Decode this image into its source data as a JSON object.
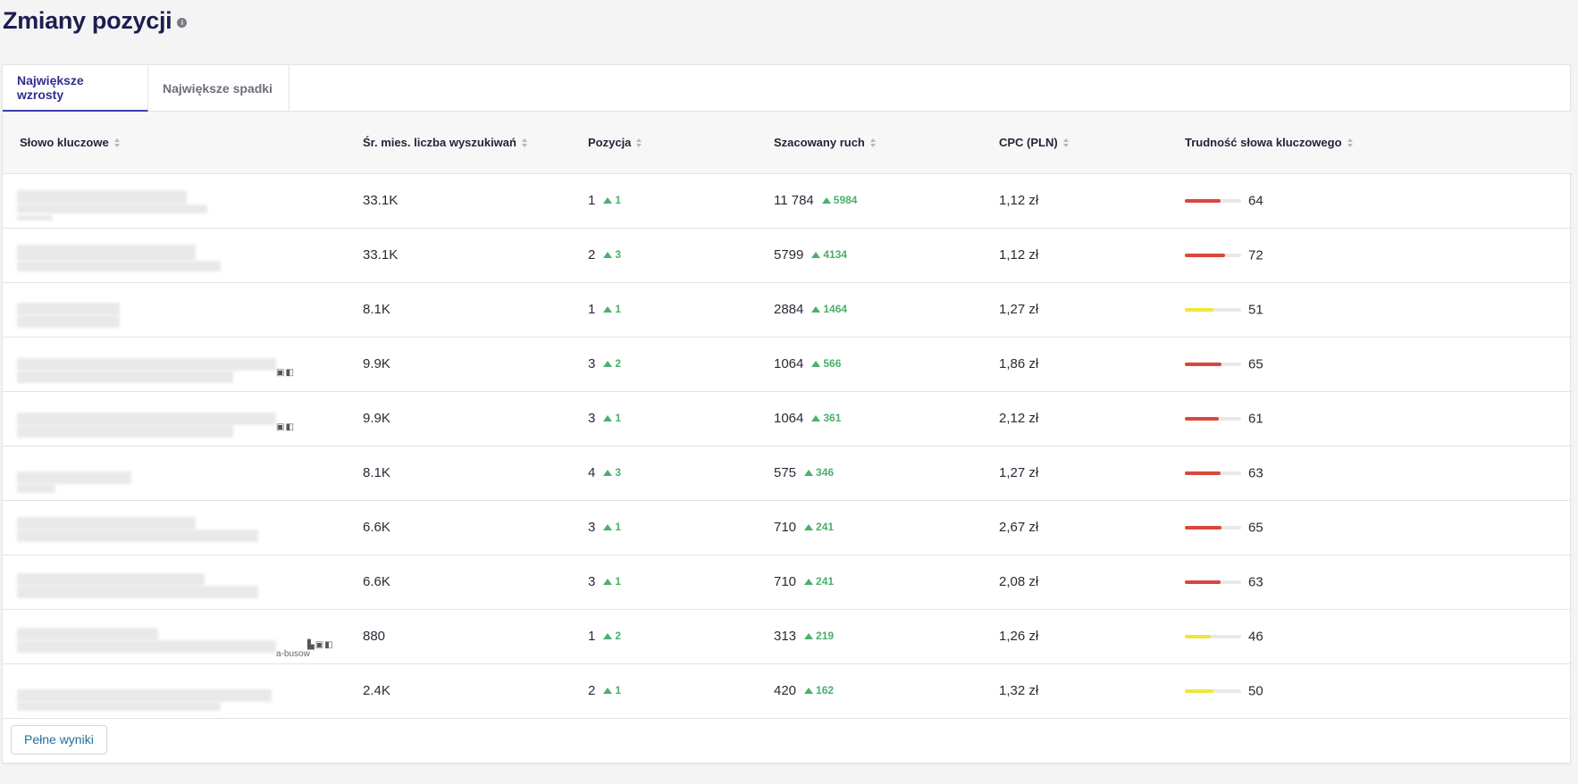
{
  "page": {
    "title": "Zmiany pozycji",
    "info_icon": "info-icon"
  },
  "tabs": [
    {
      "label": "Największe wzrosty",
      "active": true
    },
    {
      "label": "Największe spadki",
      "active": false
    }
  ],
  "table": {
    "headers": {
      "keyword": "Słowo kluczowe",
      "searches": "Śr. mies. liczba wyszukiwań",
      "position": "Pozycja",
      "traffic": "Szacowany ruch",
      "cpc": "CPC (PLN)",
      "difficulty": "Trudność słowa kluczowego"
    },
    "rows": [
      {
        "searches": "33.1K",
        "position": "1",
        "position_change": "1",
        "traffic": "11 784",
        "traffic_change": "5984",
        "cpc": "1,12 zł",
        "difficulty": "64",
        "difficulty_color": "#d9473c",
        "icons": "",
        "url_fragment": ""
      },
      {
        "searches": "33.1K",
        "position": "2",
        "position_change": "3",
        "traffic": "5799",
        "traffic_change": "4134",
        "cpc": "1,12 zł",
        "difficulty": "72",
        "difficulty_color": "#d9473c",
        "icons": "",
        "url_fragment": ""
      },
      {
        "searches": "8.1K",
        "position": "1",
        "position_change": "1",
        "traffic": "2884",
        "traffic_change": "1464",
        "cpc": "1,27 zł",
        "difficulty": "51",
        "difficulty_color": "#f2e53a",
        "icons": "",
        "url_fragment": ""
      },
      {
        "searches": "9.9K",
        "position": "3",
        "position_change": "2",
        "traffic": "1064",
        "traffic_change": "566",
        "cpc": "1,86 zł",
        "difficulty": "65",
        "difficulty_color": "#d9473c",
        "icons": "▣◧",
        "url_fragment": ""
      },
      {
        "searches": "9.9K",
        "position": "3",
        "position_change": "1",
        "traffic": "1064",
        "traffic_change": "361",
        "cpc": "2,12 zł",
        "difficulty": "61",
        "difficulty_color": "#d9473c",
        "icons": "▣◧",
        "url_fragment": ""
      },
      {
        "searches": "8.1K",
        "position": "4",
        "position_change": "3",
        "traffic": "575",
        "traffic_change": "346",
        "cpc": "1,27 zł",
        "difficulty": "63",
        "difficulty_color": "#d9473c",
        "icons": "",
        "url_fragment": ""
      },
      {
        "searches": "6.6K",
        "position": "3",
        "position_change": "1",
        "traffic": "710",
        "traffic_change": "241",
        "cpc": "2,67 zł",
        "difficulty": "65",
        "difficulty_color": "#d9473c",
        "icons": "",
        "url_fragment": ""
      },
      {
        "searches": "6.6K",
        "position": "3",
        "position_change": "1",
        "traffic": "710",
        "traffic_change": "241",
        "cpc": "2,08 zł",
        "difficulty": "63",
        "difficulty_color": "#d9473c",
        "icons": "",
        "url_fragment": ""
      },
      {
        "searches": "880",
        "position": "1",
        "position_change": "2",
        "traffic": "313",
        "traffic_change": "219",
        "cpc": "1,26 zł",
        "difficulty": "46",
        "difficulty_color": "#f2e53a",
        "icons": "▙▣◧",
        "url_fragment": "a-busow"
      },
      {
        "searches": "2.4K",
        "position": "2",
        "position_change": "1",
        "traffic": "420",
        "traffic_change": "162",
        "cpc": "1,32 zł",
        "difficulty": "50",
        "difficulty_color": "#f2e53a",
        "icons": "",
        "url_fragment": ""
      }
    ]
  },
  "footer": {
    "full_results_label": "Pełne wyniki"
  }
}
